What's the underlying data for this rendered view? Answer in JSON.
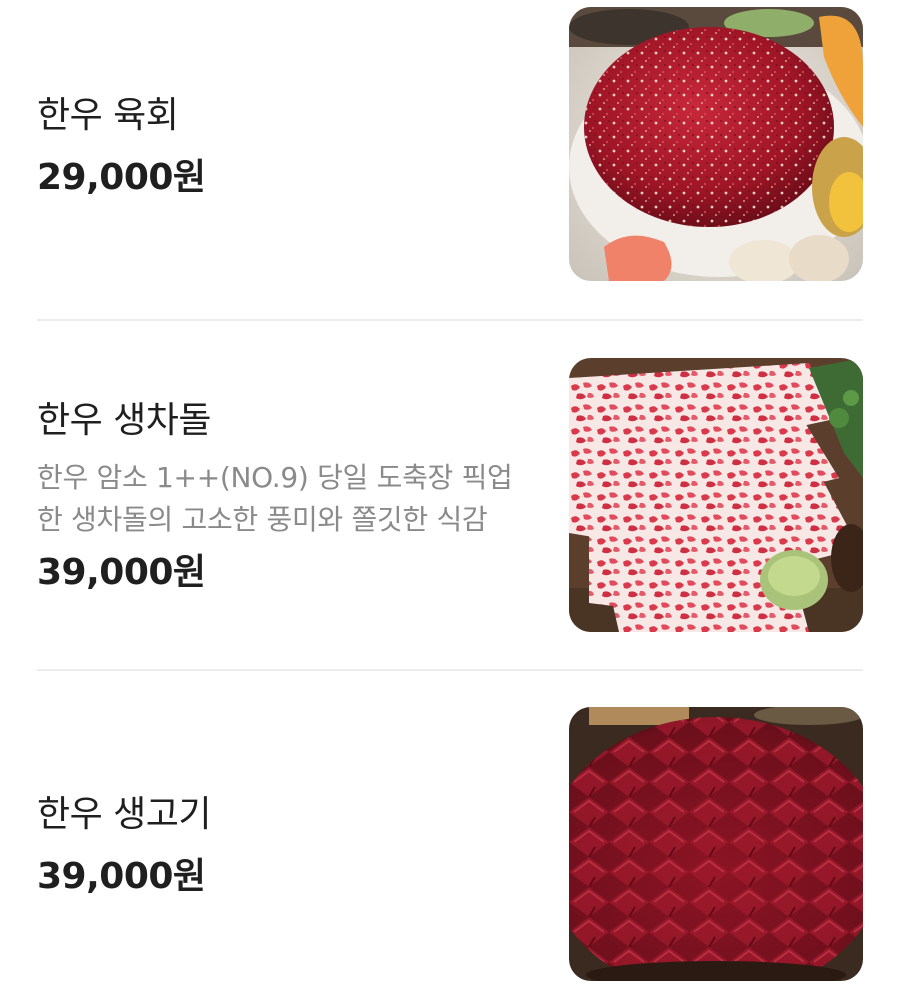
{
  "menu": {
    "items": [
      {
        "name": "한우 육회",
        "description": "",
        "price": "29,000원",
        "image_icon": "beef-tartare-photo"
      },
      {
        "name": "한우 생차돌",
        "description": "한우 암소 1++(NO.9) 당일 도축장 픽업한 생차돌의 고소한 풍미와 쫄깃한 식감",
        "price": "39,000원",
        "image_icon": "raw-brisket-photo"
      },
      {
        "name": "한우 생고기",
        "description": "",
        "price": "39,000원",
        "image_icon": "raw-beef-slices-photo"
      }
    ]
  }
}
